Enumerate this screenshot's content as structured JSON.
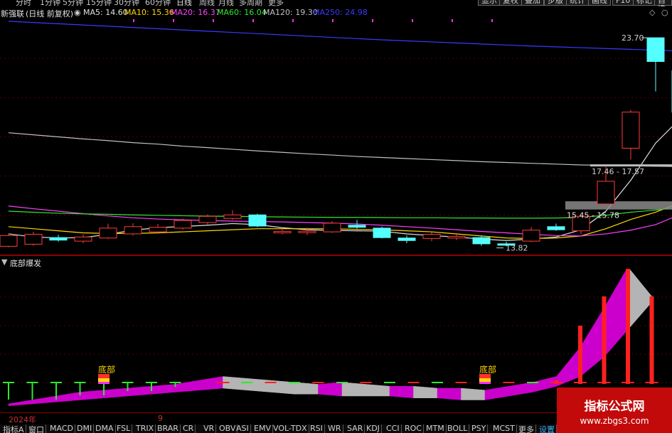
{
  "top_bar": {
    "period_tabs": [
      "分时",
      "1分钟",
      "5分钟",
      "15分钟",
      "30分钟",
      "60分钟",
      "日线",
      "周线",
      "月线",
      "多周期",
      "更多"
    ],
    "active_period": "日线",
    "tool_buttons": [
      "显示",
      "复权",
      "叠加",
      "步版",
      "统计",
      "画线",
      "F10",
      "标记",
      "自选"
    ]
  },
  "legend": {
    "stock_name": "新强联",
    "mode": "(日线 前复权)",
    "ma": [
      {
        "label": "MA5: 14.60",
        "color": "#e0e0e0"
      },
      {
        "label": "MA10: 15.36",
        "color": "#ffd700"
      },
      {
        "label": "MA20: 16.37",
        "color": "#ff40ff"
      },
      {
        "label": "MA60: 16.04",
        "color": "#2ee82e"
      },
      {
        "label": "MA120: 19.30",
        "color": "#c0c0c0"
      },
      {
        "label": "MA250: 24.98",
        "color": "#3a3aff"
      }
    ]
  },
  "price_chart": {
    "ylim": [
      13.2,
      24.6
    ],
    "annotations": {
      "high": "23.70",
      "low": "13.82",
      "resistance_zone": "17.46 - 17.57",
      "support_zone": "15.45 - 15.78"
    },
    "candles": [
      {
        "o": 13.6,
        "c": 14.12,
        "h": 14.2,
        "l": 13.55
      },
      {
        "o": 13.7,
        "c": 14.18,
        "h": 14.3,
        "l": 13.62
      },
      {
        "o": 14.02,
        "c": 13.9,
        "h": 14.15,
        "l": 13.82
      },
      {
        "o": 13.85,
        "c": 14.05,
        "h": 14.18,
        "l": 13.75
      },
      {
        "o": 14.0,
        "c": 14.48,
        "h": 14.7,
        "l": 13.95
      },
      {
        "o": 14.2,
        "c": 14.55,
        "h": 14.72,
        "l": 14.12
      },
      {
        "o": 14.3,
        "c": 14.52,
        "h": 14.68,
        "l": 14.2
      },
      {
        "o": 14.48,
        "c": 14.85,
        "h": 14.95,
        "l": 14.4
      },
      {
        "o": 14.75,
        "c": 15.05,
        "h": 15.15,
        "l": 14.65
      },
      {
        "o": 14.95,
        "c": 15.12,
        "h": 15.35,
        "l": 14.88
      },
      {
        "o": 15.12,
        "c": 14.58,
        "h": 15.18,
        "l": 14.52
      },
      {
        "o": 14.28,
        "c": 14.32,
        "h": 14.48,
        "l": 14.18
      },
      {
        "o": 14.3,
        "c": 14.33,
        "h": 14.5,
        "l": 14.14
      },
      {
        "o": 14.3,
        "c": 14.72,
        "h": 14.82,
        "l": 14.25
      },
      {
        "o": 14.62,
        "c": 14.52,
        "h": 14.88,
        "l": 14.45
      },
      {
        "o": 14.48,
        "c": 14.02,
        "h": 14.55,
        "l": 13.98
      },
      {
        "o": 14.0,
        "c": 13.88,
        "h": 14.12,
        "l": 13.75
      },
      {
        "o": 13.98,
        "c": 14.18,
        "h": 14.28,
        "l": 13.85
      },
      {
        "o": 14.0,
        "c": 14.08,
        "h": 14.2,
        "l": 13.9
      },
      {
        "o": 14.02,
        "c": 13.72,
        "h": 14.1,
        "l": 13.62
      },
      {
        "o": 13.72,
        "c": 13.66,
        "h": 13.82,
        "l": 13.6
      },
      {
        "o": 13.85,
        "c": 14.38,
        "h": 14.52,
        "l": 13.8
      },
      {
        "o": 14.55,
        "c": 14.4,
        "h": 14.7,
        "l": 14.35
      },
      {
        "o": 14.35,
        "c": 15.05,
        "h": 15.12,
        "l": 14.2
      },
      {
        "o": 15.65,
        "c": 16.75,
        "h": 17.45,
        "l": 15.6
      },
      {
        "o": 18.35,
        "c": 20.1,
        "h": 20.2,
        "l": 17.8
      },
      {
        "o": 23.7,
        "c": 22.55,
        "h": 23.72,
        "l": 21.1
      },
      {
        "o": 22.1,
        "c": 20.1,
        "h": 22.12,
        "l": 20.05
      }
    ],
    "ma_lines": {
      "MA5": [
        14.2,
        14.05,
        14.0,
        14.02,
        14.18,
        14.38,
        14.5,
        14.56,
        14.62,
        14.7,
        14.65,
        14.5,
        14.4,
        14.37,
        14.35,
        14.33,
        14.2,
        14.12,
        14.05,
        13.95,
        13.88,
        13.95,
        14.05,
        14.4,
        15.3,
        16.8,
        18.6,
        19.8
      ],
      "MA10": [
        14.55,
        14.45,
        14.35,
        14.25,
        14.22,
        14.22,
        14.25,
        14.3,
        14.35,
        14.4,
        14.45,
        14.45,
        14.45,
        14.45,
        14.42,
        14.4,
        14.35,
        14.3,
        14.2,
        14.1,
        14.0,
        13.98,
        14.0,
        14.1,
        14.45,
        14.9,
        15.25,
        15.72
      ],
      "MA20": [
        15.55,
        15.42,
        15.3,
        15.18,
        15.07,
        14.98,
        14.92,
        14.88,
        14.85,
        14.82,
        14.8,
        14.78,
        14.75,
        14.72,
        14.68,
        14.62,
        14.55,
        14.48,
        14.4,
        14.32,
        14.25,
        14.18,
        14.12,
        14.1,
        14.2,
        14.38,
        14.65,
        15.15
      ],
      "MA60": [
        15.3,
        15.25,
        15.2,
        15.17,
        15.15,
        15.12,
        15.1,
        15.08,
        15.06,
        15.05,
        15.03,
        15.02,
        15.01,
        15.0,
        15.0,
        14.99,
        14.98,
        14.98,
        14.97,
        14.97,
        14.96,
        14.96,
        14.97,
        15.0,
        15.1,
        15.25,
        15.35,
        15.5
      ],
      "MA120": [
        19.1,
        19.0,
        18.9,
        18.8,
        18.72,
        18.62,
        18.55,
        18.45,
        18.38,
        18.3,
        18.22,
        18.15,
        18.08,
        18.02,
        17.95,
        17.9,
        17.85,
        17.8,
        17.75,
        17.7,
        17.66,
        17.62,
        17.58,
        17.54,
        17.52,
        17.5,
        17.48,
        17.46
      ],
      "MA250": [
        24.5,
        24.44,
        24.38,
        24.32,
        24.26,
        24.2,
        24.14,
        24.08,
        24.02,
        23.96,
        23.9,
        23.84,
        23.78,
        23.72,
        23.66,
        23.6,
        23.55,
        23.5,
        23.45,
        23.4,
        23.35,
        23.3,
        23.26,
        23.22,
        23.18,
        23.14,
        23.1,
        23.06
      ]
    }
  },
  "indicator": {
    "name": "底部爆发",
    "signal_label": "底部",
    "top_line": [
      0,
      2,
      4,
      6,
      7,
      8,
      9,
      10,
      12,
      14,
      13,
      12,
      11,
      10,
      11,
      10,
      9,
      9,
      8,
      8,
      7,
      9,
      11,
      14,
      29,
      49,
      70,
      55
    ],
    "bottom_line": [
      -1,
      0,
      1,
      2,
      3,
      4,
      5,
      6,
      7,
      8,
      7,
      6,
      5,
      5,
      4,
      4,
      4,
      3,
      3,
      2,
      2,
      4,
      6,
      9,
      14,
      24,
      38,
      52
    ],
    "red_bars": [
      0,
      0,
      0,
      0,
      0,
      0,
      0,
      0,
      0,
      5,
      0,
      0,
      0,
      0,
      0,
      0,
      0,
      0,
      0,
      0,
      0,
      0,
      0,
      12,
      40,
      55,
      70,
      55
    ],
    "green_bars": [
      4,
      4,
      4,
      3,
      3,
      2,
      2,
      1,
      0,
      0,
      0,
      0,
      0,
      0,
      0,
      0,
      0,
      0,
      0,
      0,
      0,
      0,
      0,
      0,
      0,
      0,
      0,
      0
    ],
    "signals": [
      4,
      20
    ]
  },
  "time_axis": {
    "labels": [
      "2024年",
      "9"
    ]
  },
  "bottom_tabs": [
    "指标A",
    "窗口",
    "MACD",
    "DMI",
    "DMA",
    "FSL",
    "TRIX",
    "BRAR",
    "CR",
    "VR",
    "OBV",
    "ASI",
    "EMV",
    "VOL-TDX",
    "RSI",
    "WR",
    "SAR",
    "KDJ",
    "CCI",
    "ROC",
    "MTM",
    "BOLL",
    "PSY",
    "MCST",
    "更多",
    "设置"
  ],
  "watermark": {
    "name": "指标公式网",
    "url": "www.zbgs3.com"
  }
}
